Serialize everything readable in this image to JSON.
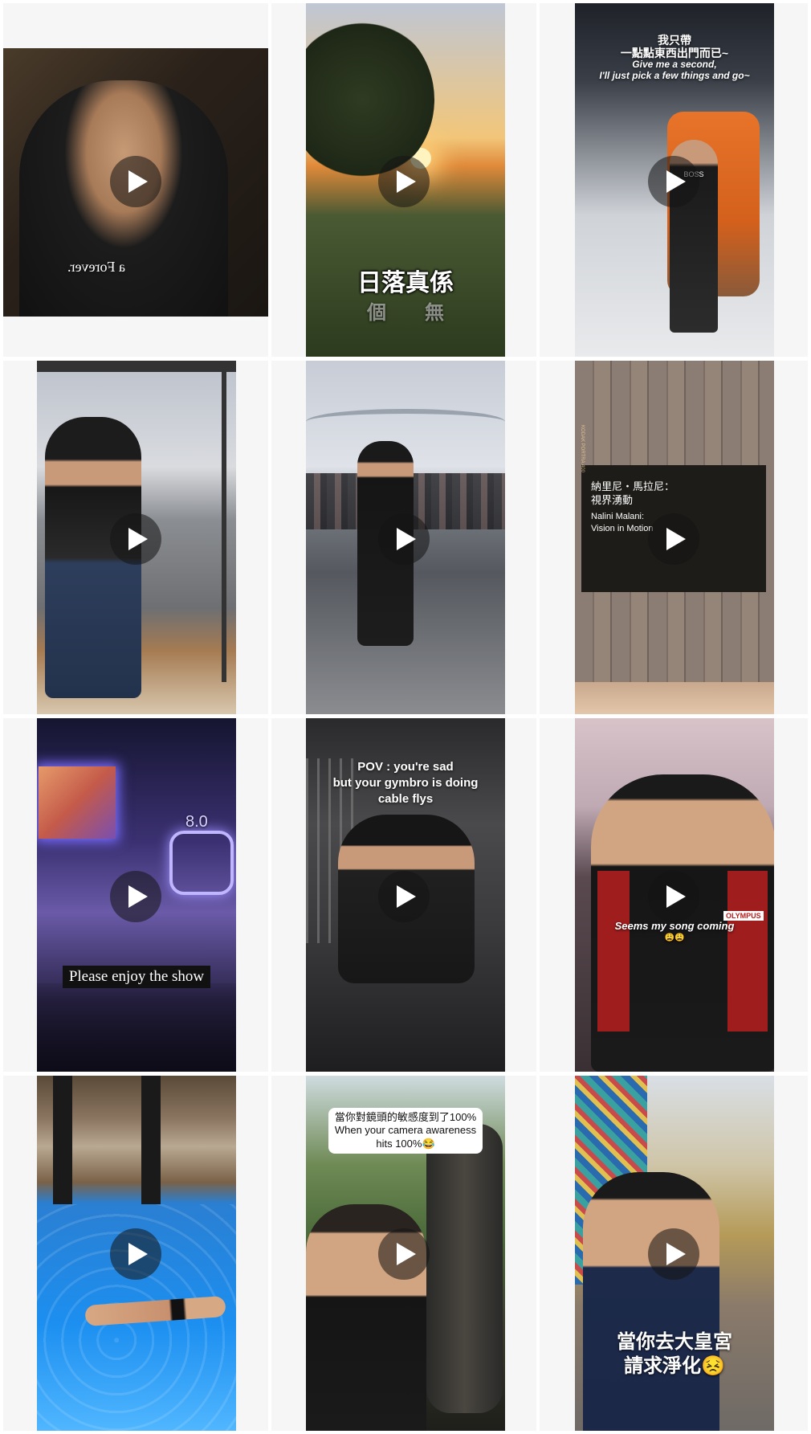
{
  "grid": {
    "posts": [
      {
        "id": "p1",
        "caption_lines": [],
        "overlay_text": "a Forever."
      },
      {
        "id": "p2",
        "caption_lines": [
          "日落真係"
        ],
        "overlay_text": "個　　無"
      },
      {
        "id": "p3",
        "caption_lines": [
          "我只帶",
          "一點點東西出門而已~",
          "Give me a second,",
          "I'll just pick a few things and go~"
        ],
        "overlay_text": "BOSS"
      },
      {
        "id": "p4",
        "caption_lines": [],
        "overlay_text": ""
      },
      {
        "id": "p5",
        "caption_lines": [],
        "overlay_text": ""
      },
      {
        "id": "p6",
        "caption_lines": [
          "納里尼・馬拉尼：",
          "視界湧動",
          "Nalini Malani:",
          "Vision in Motion"
        ],
        "overlay_text": "KODAK PORTRA 400"
      },
      {
        "id": "p7",
        "caption_lines": [
          "Please enjoy the show"
        ],
        "overlay_text": "8.0"
      },
      {
        "id": "p8",
        "caption_lines": [
          "POV : you're sad",
          "but your gymbro is doing",
          "cable flys"
        ],
        "overlay_text": ""
      },
      {
        "id": "p9",
        "caption_lines": [
          "Seems my song coming",
          "😩😩"
        ],
        "overlay_text": "OLYMPUS"
      },
      {
        "id": "p10",
        "caption_lines": [],
        "overlay_text": ""
      },
      {
        "id": "p11",
        "caption_lines": [
          "當你對鏡頭的敏感度到了100%",
          "When your camera awareness",
          "hits 100%😂"
        ],
        "overlay_text": ""
      },
      {
        "id": "p12",
        "caption_lines": [
          "當你去大皇宮",
          "請求淨化😣"
        ],
        "overlay_text": ""
      }
    ]
  },
  "icons": {
    "play": "play-icon"
  },
  "colors": {
    "page_bg": "#ffffff",
    "cell_bg": "#f6f6f7",
    "play_bg": "rgba(20,20,20,0.55)"
  }
}
